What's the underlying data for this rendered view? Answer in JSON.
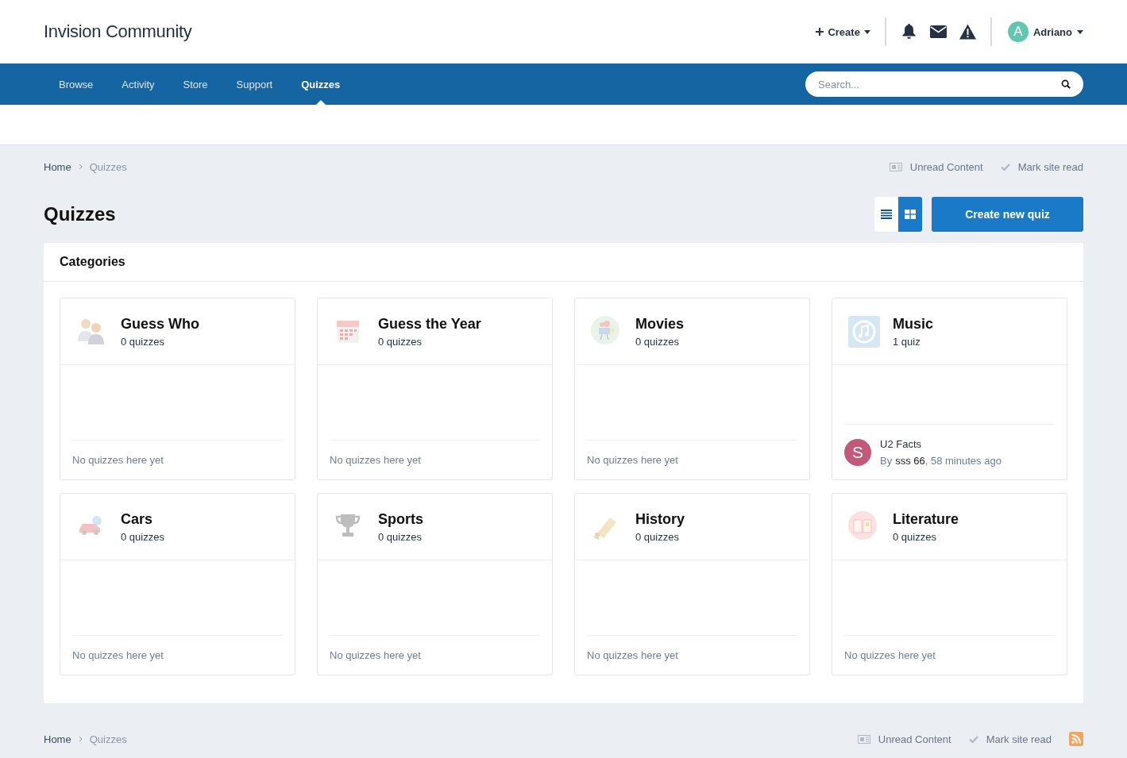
{
  "site": {
    "title": "Invision Community"
  },
  "user_bar": {
    "create": "Create",
    "user": {
      "name": "Adriano",
      "avatar_letter": "A"
    }
  },
  "nav": {
    "tabs": [
      {
        "label": "Browse",
        "selected": false
      },
      {
        "label": "Activity",
        "selected": false
      },
      {
        "label": "Store",
        "selected": false
      },
      {
        "label": "Support",
        "selected": false
      },
      {
        "label": "Quizzes",
        "selected": true
      }
    ],
    "search": {
      "placeholder": "Search..."
    }
  },
  "breadcrumb": {
    "items": [
      "Home",
      "Quizzes"
    ],
    "links": [
      {
        "kind": "unread",
        "label": "Unread Content"
      },
      {
        "kind": "markread",
        "label": "Mark site read"
      }
    ]
  },
  "page": {
    "title": "Quizzes",
    "views": [
      {
        "kind": "list",
        "selected": false
      },
      {
        "kind": "grid",
        "selected": true
      }
    ],
    "create_button": "Create new quiz"
  },
  "categories": {
    "title": "Categories",
    "items": [
      {
        "kind": "people",
        "name": "Guess Who",
        "count": "0 quizzes",
        "empty": "No quizzes here yet"
      },
      {
        "kind": "calendar",
        "name": "Guess the Year",
        "count": "0 quizzes",
        "empty": "No quizzes here yet"
      },
      {
        "kind": "camera",
        "name": "Movies",
        "count": "0 quizzes",
        "empty": "No quizzes here yet"
      },
      {
        "kind": "music",
        "name": "Music",
        "count": "1 quiz",
        "latest": {
          "title": "U2 Facts",
          "by": "By",
          "author": "sss 66",
          "after": ", 58 minutes ago",
          "avatar_letter": "S"
        }
      },
      {
        "kind": "car",
        "name": "Cars",
        "count": "0 quizzes",
        "empty": "No quizzes here yet"
      },
      {
        "kind": "trophy",
        "name": "Sports",
        "count": "0 quizzes",
        "empty": "No quizzes here yet"
      },
      {
        "kind": "scroll",
        "name": "History",
        "count": "0 quizzes",
        "empty": "No quizzes here yet"
      },
      {
        "kind": "book",
        "name": "Literature",
        "count": "0 quizzes",
        "empty": "No quizzes here yet"
      }
    ]
  },
  "footer_breadcrumb": {
    "items": [
      "Home",
      "Quizzes"
    ],
    "links": [
      {
        "kind": "unread",
        "label": "Unread Content"
      },
      {
        "kind": "markread",
        "label": "Mark site read"
      }
    ]
  }
}
